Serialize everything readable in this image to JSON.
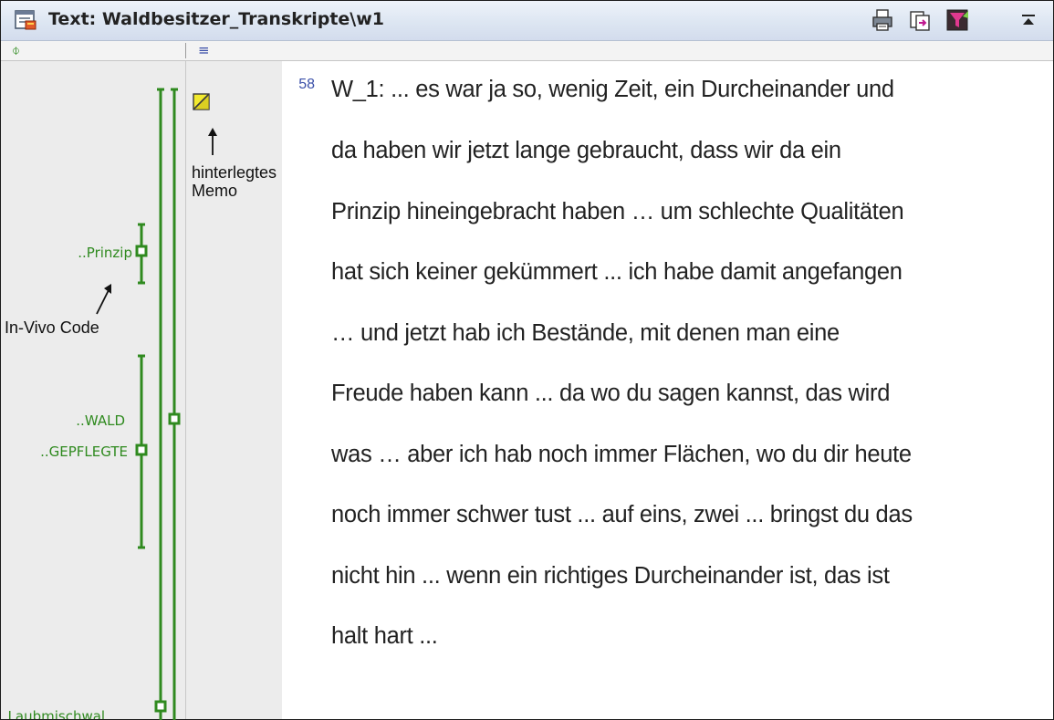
{
  "window": {
    "title": "Text: Waldbesitzer_Transkripte\\w1",
    "toolbar_icons": [
      "print-icon",
      "export-icon",
      "filter-icon",
      "collapse-icon"
    ]
  },
  "column_header": {
    "codes_icon": "code-column-icon",
    "memo_icon": "memo-column-icon"
  },
  "paragraph_number": "58",
  "text_lines": [
    "W_1: ... es war ja so, wenig Zeit, ein Durcheinander und",
    "da haben wir jetzt lange gebraucht, dass wir da ein",
    "Prinzip hineingebracht haben … um schlechte Qualitäten",
    "hat sich keiner gekümmert ... ich habe damit angefangen",
    "… und jetzt hab ich Bestände, mit denen man eine",
    "Freude haben kann ... da wo du sagen kannst, das wird",
    "was … aber ich hab noch immer Flächen, wo du dir heute",
    "noch immer schwer tust ... auf eins, zwei ... bringst du das",
    "nicht hin ... wenn ein richtiges Durcheinander ist, das ist",
    "halt hart ..."
  ],
  "codes": {
    "prinzip": "..Prinzip",
    "wald": "..WALD",
    "gepflegte": "..GEPFLEGTE",
    "laubmischwal": "..Laubmischwal"
  },
  "annotations": {
    "memo_line1": "hinterlegtes",
    "memo_line2": "Memo",
    "invivo": "In-Vivo Code"
  },
  "colors": {
    "code_green": "#2f8a1f",
    "memo_yellow": "#f2ea2e",
    "line_number_blue": "#3a4fa8"
  }
}
